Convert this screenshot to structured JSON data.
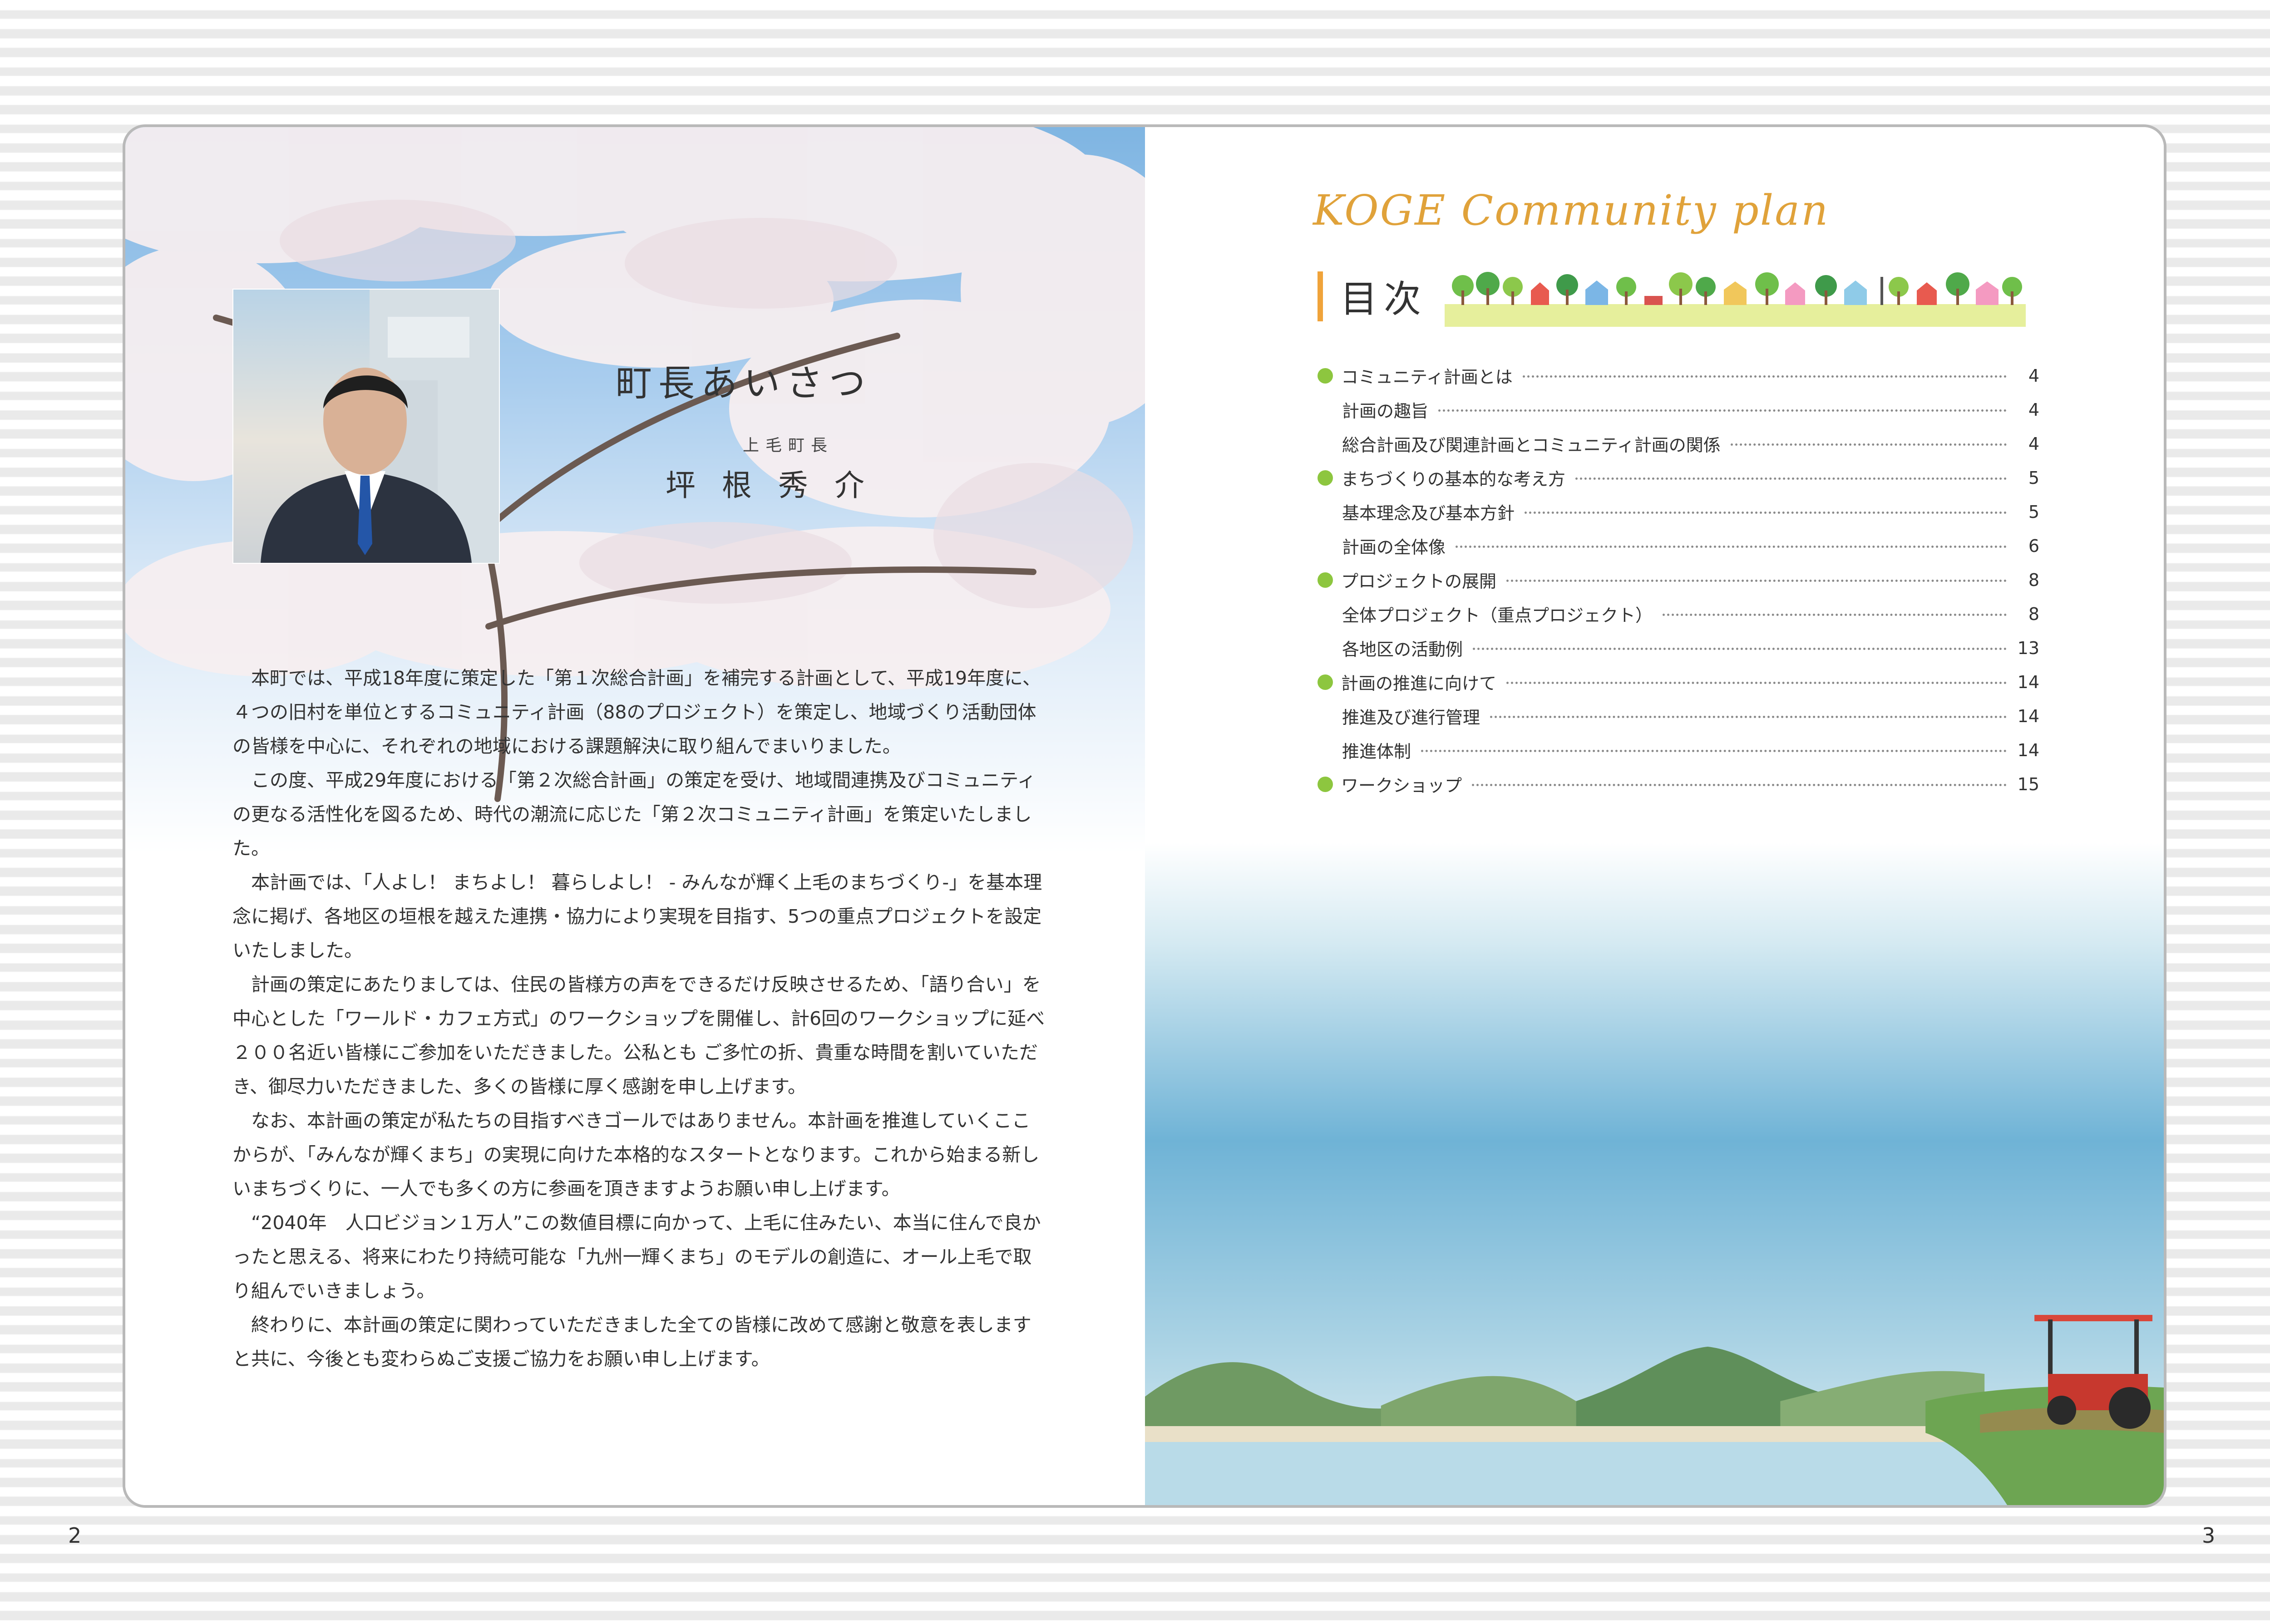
{
  "left_page": {
    "title": "町長あいさつ",
    "author_role": "上毛町長",
    "author_name": "坪根秀介",
    "paragraphs": [
      "本町では、平成18年度に策定した「第１次総合計画」を補完する計画として、平成19年度に、４つの旧村を単位とするコミュニティ計画（88のプロジェクト）を策定し、地域づくり活動団体の皆様を中心に、それぞれの地域における課題解決に取り組んでまいりました。",
      "この度、平成29年度における「第２次総合計画」の策定を受け、地域間連携及びコミュニティの更なる活性化を図るため、時代の潮流に応じた「第２次コミュニティ計画」を策定いたしました。",
      "本計画では、「人よし！ まちよし！ 暮らしよし！ - みんなが輝く上毛のまちづくり-」を基本理念に掲げ、各地区の垣根を越えた連携・協力により実現を目指す、5つの重点プロジェクトを設定いたしました。",
      "計画の策定にあたりましては、住民の皆様方の声をできるだけ反映させるため、「語り合い」を中心とした「ワールド・カフェ方式」のワークショップを開催し、計6回のワークショップに延べ２００名近い皆様にご参加をいただきました。公私とも ご多忙の折、貴重な時間を割いていただき、御尽力いただきました、多くの皆様に厚く感謝を申し上げます。",
      "なお、本計画の策定が私たちの目指すべきゴールではありません。本計画を推進していくここからが、「みんなが輝くまち」の実現に向けた本格的なスタートとなります。これから始まる新しいまちづくりに、一人でも多くの方に参画を頂きますようお願い申し上げます。",
      "“2040年　人口ビジョン１万人”この数値目標に向かって、上毛に住みたい、本当に住んで良かったと思える、将来にわたり持続可能な「九州一輝くまち」のモデルの創造に、オール上毛で取り組んでいきましょう。",
      "終わりに、本計画の策定に関わっていただきました全ての皆様に改めて感謝と敬意を表しますと共に、今後とも変わらぬご支援ご協力をお願い申し上げます。"
    ],
    "page_number": "2"
  },
  "right_page": {
    "brand": "KOGE Community plan",
    "toc_title": "目次",
    "toc": [
      {
        "label": "コミュニティ計画とは",
        "page": "4",
        "level": 1
      },
      {
        "label": "計画の趣旨",
        "page": "4",
        "level": 2
      },
      {
        "label": "総合計画及び関連計画とコミュニティ計画の関係",
        "page": "4",
        "level": 2
      },
      {
        "label": "まちづくりの基本的な考え方",
        "page": "5",
        "level": 1
      },
      {
        "label": "基本理念及び基本方針",
        "page": "5",
        "level": 2
      },
      {
        "label": "計画の全体像",
        "page": "6",
        "level": 2
      },
      {
        "label": "プロジェクトの展開",
        "page": "8",
        "level": 1
      },
      {
        "label": "全体プロジェクト（重点プロジェクト）",
        "page": "8",
        "level": 2
      },
      {
        "label": "各地区の活動例",
        "page": "13",
        "level": 2
      },
      {
        "label": "計画の推進に向けて",
        "page": "14",
        "level": 1
      },
      {
        "label": "推進及び進行管理",
        "page": "14",
        "level": 2
      },
      {
        "label": "推進体制",
        "page": "14",
        "level": 2
      },
      {
        "label": "ワークショップ",
        "page": "15",
        "level": 1
      }
    ],
    "page_number": "3"
  },
  "colors": {
    "accent_orange": "#e0a23a",
    "bullet_green": "#8dc63f",
    "frame_gray": "#b9b9b9"
  },
  "icons": {
    "town_strip": "tree-and-house-icons",
    "bullet": "green-dot-icon"
  }
}
